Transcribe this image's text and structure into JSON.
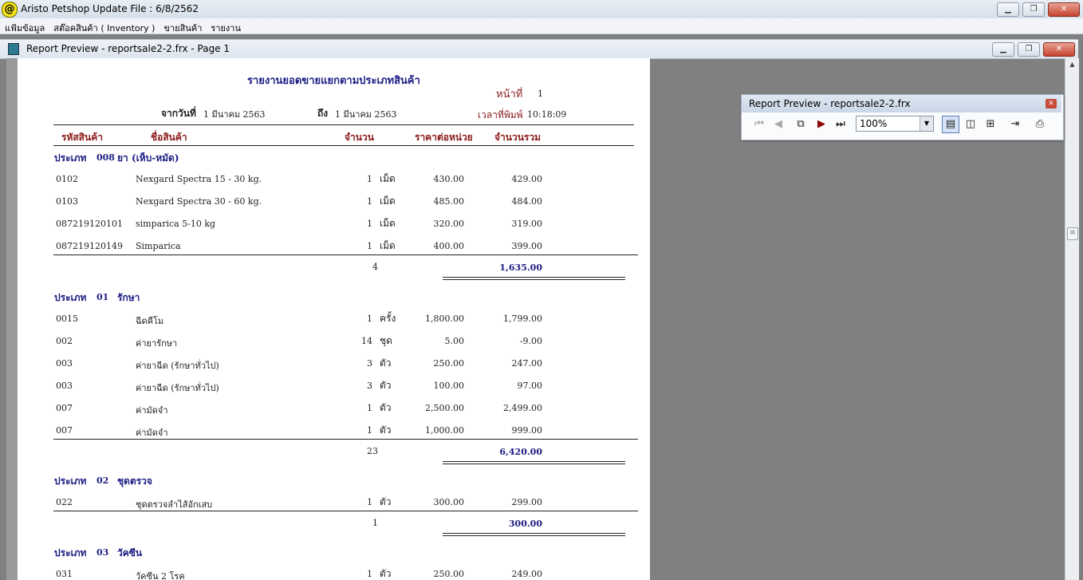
{
  "window": {
    "title": "Aristo Petshop  Update File : 6/8/2562"
  },
  "menu": [
    "แฟ้มข้อมูล",
    "สต๊อคสินค้า ( Inventory )",
    "ขายสินค้า",
    "รายงาน"
  ],
  "child": {
    "title": "Report Preview - reportsale2-2.frx - Page 1"
  },
  "report": {
    "title": "รายงานยอดขายแยกตามประเภทสินค้า",
    "page_label": "หน้าที่",
    "page_no": "1",
    "from_label": "จากวันที่",
    "from_date": "1 มีนาคม 2563",
    "to_label": "ถึง",
    "to_date": "1 มีนาคม 2563",
    "time_label": "เวลาที่พิมพ์",
    "time_value": "10:18:09",
    "columns": [
      "รหัสสินค้า",
      "ชื่อสินค้า",
      "จำนวน",
      "ราคาต่อหน่วย",
      "จำนวนรวม"
    ],
    "groups": [
      {
        "label": "ประเภท",
        "code": "008",
        "name": "ยา (เห็บ-หมัด)",
        "rows": [
          {
            "code": "0102",
            "name": "Nexgard Spectra 15 - 30 kg.",
            "qty": "1",
            "unit": "เม็ด",
            "price": "430.00",
            "total": "429.00"
          },
          {
            "code": "0103",
            "name": "Nexgard Spectra 30 - 60 kg.",
            "qty": "1",
            "unit": "เม็ด",
            "price": "485.00",
            "total": "484.00"
          },
          {
            "code": "087219120101",
            "name": "simparica 5-10 kg",
            "qty": "1",
            "unit": "เม็ด",
            "price": "320.00",
            "total": "319.00"
          },
          {
            "code": "087219120149",
            "name": "Simparica",
            "qty": "1",
            "unit": "เม็ด",
            "price": "400.00",
            "total": "399.00"
          }
        ],
        "sum_qty": "4",
        "sum_total": "1,635.00"
      },
      {
        "label": "ประเภท",
        "code": "01",
        "name": "รักษา",
        "rows": [
          {
            "code": "0015",
            "name": "ฉีดคีโม",
            "qty": "1",
            "unit": "ครั้ง",
            "price": "1,800.00",
            "total": "1,799.00"
          },
          {
            "code": "002",
            "name": "ค่ายารักษา",
            "qty": "14",
            "unit": "ชุด",
            "price": "5.00",
            "total": "-9.00"
          },
          {
            "code": "003",
            "name": "ค่ายาฉีด (รักษาทั่วไป)",
            "qty": "3",
            "unit": "ตัว",
            "price": "250.00",
            "total": "247.00"
          },
          {
            "code": "003",
            "name": "ค่ายาฉีด (รักษาทั่วไป)",
            "qty": "3",
            "unit": "ตัว",
            "price": "100.00",
            "total": "97.00"
          },
          {
            "code": "007",
            "name": "ค่ามัดจำ",
            "qty": "1",
            "unit": "ตัว",
            "price": "2,500.00",
            "total": "2,499.00"
          },
          {
            "code": "007",
            "name": "ค่ามัดจำ",
            "qty": "1",
            "unit": "ตัว",
            "price": "1,000.00",
            "total": "999.00"
          }
        ],
        "sum_qty": "23",
        "sum_total": "6,420.00"
      },
      {
        "label": "ประเภท",
        "code": "02",
        "name": "ชุดตรวจ",
        "rows": [
          {
            "code": "022",
            "name": "ชุดตรวจลำไส้อักเสบ",
            "qty": "1",
            "unit": "ตัว",
            "price": "300.00",
            "total": "299.00"
          }
        ],
        "sum_qty": "1",
        "sum_total": "300.00"
      },
      {
        "label": "ประเภท",
        "code": "03",
        "name": "วัคซีน",
        "rows": [
          {
            "code": "031",
            "name": "วัคซีน 2 โรค",
            "qty": "1",
            "unit": "ตัว",
            "price": "250.00",
            "total": "249.00"
          }
        ]
      }
    ]
  },
  "preview_toolbar": {
    "title": "Report Preview - reportsale2-2.frx",
    "zoom": "100%",
    "icons": [
      "first-page-icon",
      "prev-page-icon",
      "copy-icon",
      "next-page-icon",
      "last-page-icon",
      "one-page-icon",
      "two-page-icon",
      "multi-page-icon",
      "close-preview-icon",
      "print-icon"
    ]
  }
}
